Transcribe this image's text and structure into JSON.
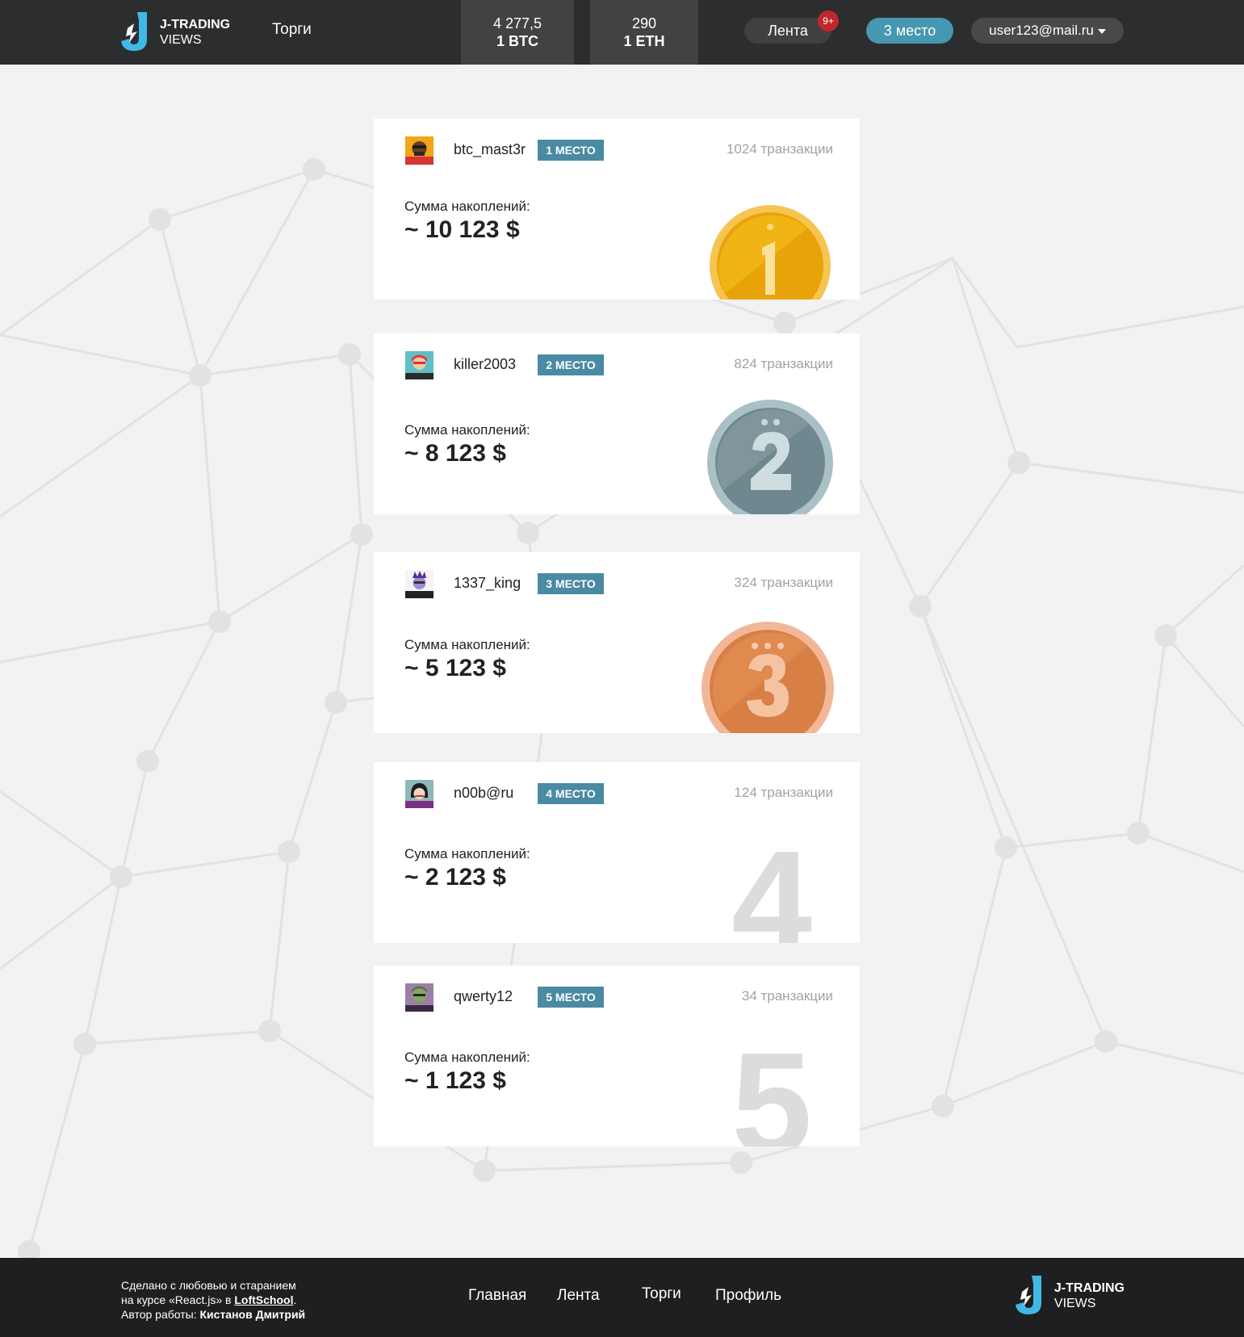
{
  "header": {
    "logo": {
      "line1": "J-TRADING",
      "line2": "VIEWS"
    },
    "nav_trade": "Торги",
    "rates": [
      {
        "value": "4 277,5",
        "currency": "1 BTC"
      },
      {
        "value": "290",
        "currency": "1 ETH"
      }
    ],
    "feed_label": "Лента",
    "feed_badge": "9+",
    "place_label": "3 место",
    "user_email": "user123@mail.ru"
  },
  "leaders": [
    {
      "username": "btc_mast3r",
      "place": "1 МЕСТО",
      "transactions": "1024 транзакции",
      "sum_label": "Сумма накоплений:",
      "sum": "~ 10 123 $",
      "medal": "gold-medal",
      "number": "1"
    },
    {
      "username": "killer2003",
      "place": "2 МЕСТО",
      "transactions": "824 транзакции",
      "sum_label": "Сумма накоплений:",
      "sum": "~ 8 123 $",
      "medal": "silver-medal",
      "number": "2"
    },
    {
      "username": "1337_king",
      "place": "3 МЕСТО",
      "transactions": "324 транзакции",
      "sum_label": "Сумма накоплений:",
      "sum": "~ 5 123 $",
      "medal": "bronze-medal",
      "number": "3"
    },
    {
      "username": "n00b@ru",
      "place": "4 МЕСТО",
      "transactions": "124 транзакции",
      "sum_label": "Сумма накоплений:",
      "sum": "~ 2 123 $",
      "number": "4"
    },
    {
      "username": "qwerty12",
      "place": "5 МЕСТО",
      "transactions": "34 транзакции",
      "sum_label": "Сумма накоплений:",
      "sum": "~ 1 123 $",
      "number": "5"
    }
  ],
  "footer": {
    "credit_line1": "Сделано с любовью и старанием",
    "credit_line2_pre": "на курсе «React.js» в ",
    "credit_link": "LoftSchool",
    "credit_line2_post": ".",
    "credit_line3_pre": "Автор работы: ",
    "credit_author": "Кистанов Дмитрий",
    "nav": [
      "Главная",
      "Лента",
      "Торги",
      "Профиль"
    ],
    "logo": {
      "line1": "J-TRADING",
      "line2": "VIEWS"
    }
  },
  "colors": {
    "header_bg": "#2c2d2f",
    "accent": "#4697b0",
    "place_tag": "#4a8aa3",
    "badge": "#c0272d",
    "footer_bg": "#1e1f21",
    "logo": "#3fb9e6"
  }
}
